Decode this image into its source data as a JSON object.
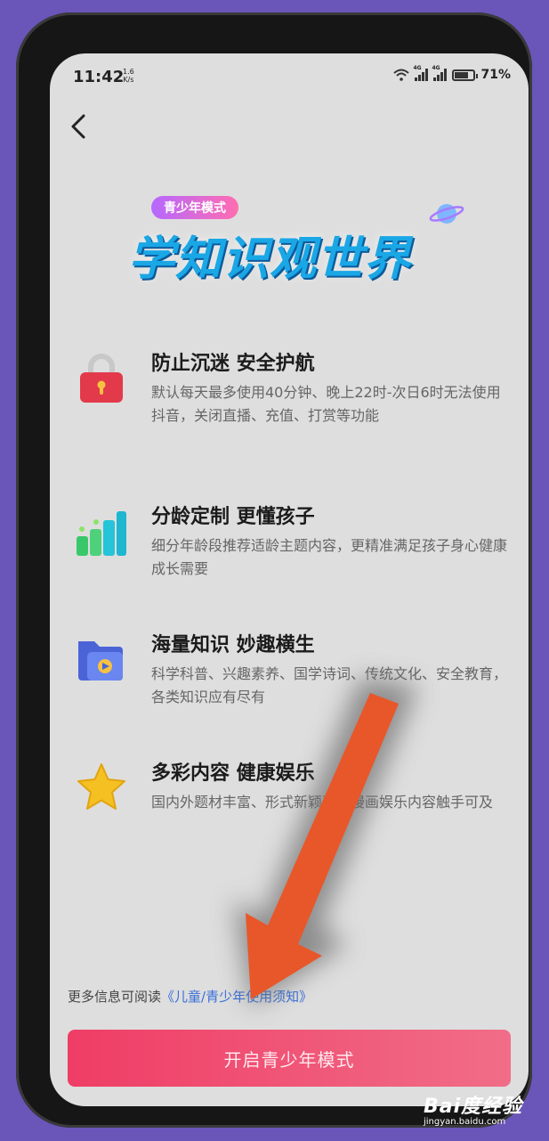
{
  "status_bar": {
    "time": "11:42",
    "speed_value": "1.6",
    "speed_unit": "K/s",
    "network_tag": "4G",
    "battery": "71%",
    "battery_level": 0.71
  },
  "banner": {
    "mode_label": "青少年模式",
    "slogan": "学知识观世界"
  },
  "features": [
    {
      "title": "防止沉迷 安全护航",
      "desc": "默认每天最多使用40分钟、晚上22时-次日6时无法使用抖音，关闭直播、充值、打赏等功能",
      "icon": "lock-icon"
    },
    {
      "title": "分龄定制 更懂孩子",
      "desc": "细分年龄段推荐适龄主题内容，更精准满足孩子身心健康成长需要",
      "icon": "bar-chart-icon"
    },
    {
      "title": "海量知识 妙趣横生",
      "desc": "科学科普、兴趣素养、国学诗词、传统文化、安全教育，各类知识应有尽有",
      "icon": "video-folder-icon"
    },
    {
      "title": "多彩内容 健康娱乐",
      "desc": "国内外题材丰富、形式新颖正向漫画娱乐内容触手可及",
      "icon": "star-icon"
    }
  ],
  "footer": {
    "more_info_prefix": "更多信息可阅读",
    "more_info_link": "《儿童/青少年使用须知》",
    "open_button": "开启青少年模式"
  },
  "watermark": {
    "logo": "Bai度经验",
    "url": "jingyan.baidu.com"
  },
  "colors": {
    "background": "#6a55b8",
    "button": "#ef3d66",
    "link": "#3a6fd8",
    "arrow": "#e8572a"
  }
}
